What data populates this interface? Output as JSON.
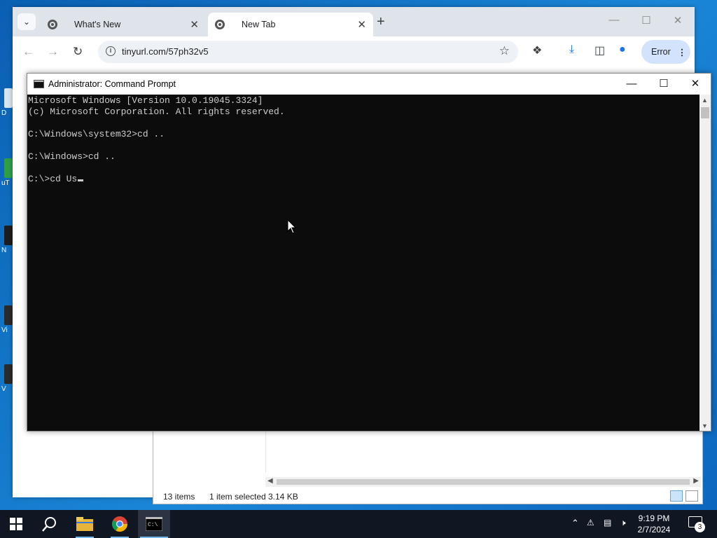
{
  "desktop": {
    "icon_labels": [
      "D",
      "uT",
      "N",
      "Vi",
      "V"
    ]
  },
  "chrome": {
    "tabs": [
      {
        "label": "What's New",
        "active": false
      },
      {
        "label": "New Tab",
        "active": true
      }
    ],
    "url": "tinyurl.com/57ph32v5",
    "profile_button": "Error",
    "icons": {
      "tab_search": "chevron-down-icon",
      "new_tab": "plus-icon",
      "back": "arrow-left-icon",
      "forward": "arrow-right-icon",
      "reload": "reload-icon",
      "site_info": "info-icon",
      "bookmark": "star-icon",
      "extensions": "puzzle-icon",
      "downloads": "download-icon",
      "side_panel": "side-panel-icon",
      "profile": "person-icon"
    }
  },
  "cmd": {
    "title": "Administrator: Command Prompt",
    "lines": [
      "Microsoft Windows [Version 10.0.19045.3324]",
      "(c) Microsoft Corporation. All rights reserved.",
      "",
      "C:\\Windows\\system32>cd ..",
      "",
      "C:\\Windows>cd ..",
      "",
      "C:\\>cd Us"
    ]
  },
  "explorer": {
    "item_count": "13 items",
    "selection": "1 item selected",
    "size": "3.14 KB"
  },
  "taskbar": {
    "apps": [
      "start-icon",
      "search-icon",
      "file-explorer-icon",
      "chrome-icon",
      "command-prompt-icon"
    ],
    "time": "9:19 PM",
    "date": "2/7/2024",
    "notification_count": "3"
  },
  "colors": {
    "console_bg": "#0c0c0c",
    "console_text": "#cccccc",
    "taskbar_bg": "#101622",
    "chrome_accent": "#d3e3fd"
  }
}
